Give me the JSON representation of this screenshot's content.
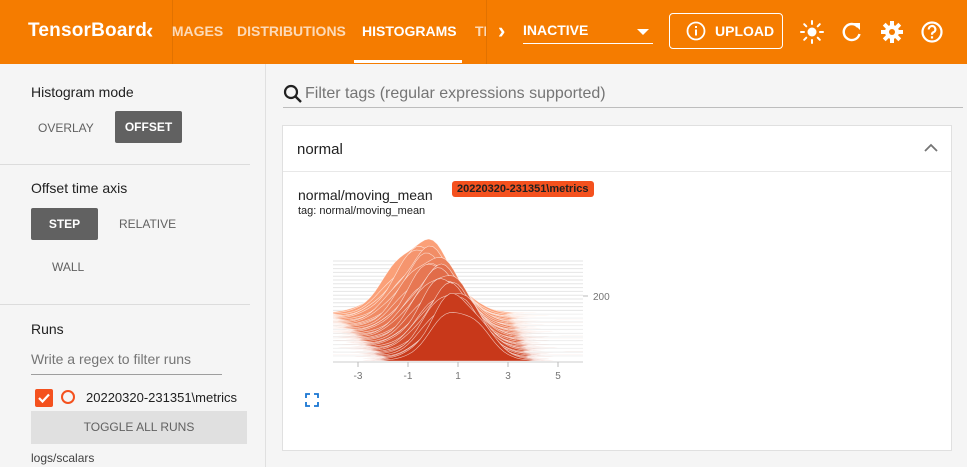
{
  "app": {
    "title": "TensorBoard"
  },
  "nav": {
    "tabs": [
      {
        "label": "IMAGES",
        "active": false
      },
      {
        "label": "DISTRIBUTIONS",
        "active": false
      },
      {
        "label": "HISTOGRAMS",
        "active": true
      },
      {
        "label": "TIME SERIES",
        "active": false
      }
    ],
    "plugin_select_value": "INACTIVE",
    "upload_label": "UPLOAD"
  },
  "icons": {
    "prev": "chevron-left-icon",
    "next": "chevron-right-icon",
    "upload": "info-icon",
    "theme": "sun-icon",
    "reload": "refresh-icon",
    "settings": "gear-icon",
    "help": "help-icon",
    "search": "search-icon",
    "collapse": "chevron-up-icon",
    "expand": "fullscreen-icon"
  },
  "colors": {
    "brand": "#f57c00",
    "run": "#f4511e",
    "button_dark": "#616161"
  },
  "sidebar": {
    "histogram_mode": {
      "title": "Histogram mode",
      "options": [
        "OVERLAY",
        "OFFSET"
      ],
      "selected": "OFFSET"
    },
    "offset_time_axis": {
      "title": "Offset time axis",
      "options": [
        "STEP",
        "RELATIVE",
        "WALL"
      ],
      "selected": "STEP"
    },
    "runs": {
      "title": "Runs",
      "filter_placeholder": "Write a regex to filter runs",
      "items": [
        {
          "name": "20220320-231351\\metrics",
          "checked": true
        }
      ],
      "toggle_all_label": "TOGGLE ALL RUNS",
      "logdir": "logs/scalars"
    }
  },
  "main": {
    "search_placeholder": "Filter tags (regular expressions supported)",
    "groups": [
      {
        "name": "normal",
        "cards": [
          {
            "title": "normal/moving_mean",
            "tag_line": "tag: normal/moving_mean",
            "run_chip": "20220320-231351\\metrics"
          }
        ]
      }
    ]
  },
  "chart_data": {
    "type": "area",
    "mode": "offset",
    "x_ticks": [
      "-3",
      "-1",
      "1",
      "3",
      "5"
    ],
    "y_ticks": [
      "200"
    ],
    "xlim": [
      -4,
      6
    ],
    "distribution": {
      "initial_center": -0.5,
      "final_center": 1.0,
      "initial_sigma": 1.2,
      "final_sigma": 1.0
    },
    "color_front": "#c8381a",
    "color_back": "#fca37a"
  }
}
